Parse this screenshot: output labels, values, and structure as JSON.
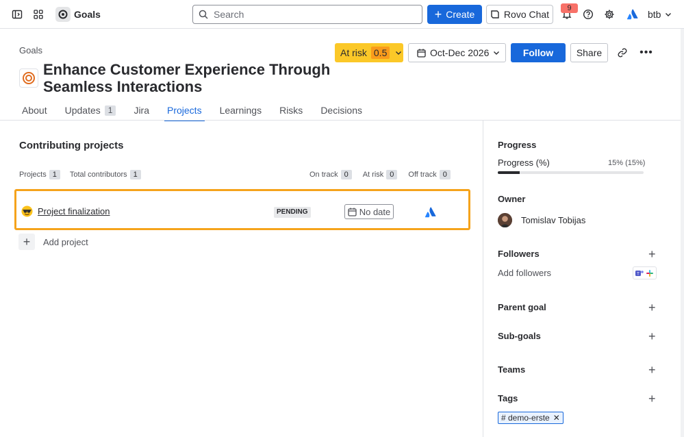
{
  "topnav": {
    "app_name": "Goals",
    "search_placeholder": "Search",
    "create_label": "Create",
    "rovo_label": "Rovo Chat",
    "notification_count": "9",
    "user_label": "btb"
  },
  "header": {
    "breadcrumb": "Goals",
    "title": "Enhance Customer Experience Through Seamless Interactions",
    "status_label": "At risk",
    "status_score": "0.5",
    "date_range": "Oct-Dec 2026",
    "follow_label": "Follow",
    "share_label": "Share"
  },
  "tabs": [
    {
      "label": "About",
      "count": ""
    },
    {
      "label": "Updates",
      "count": "1"
    },
    {
      "label": "Jira",
      "count": ""
    },
    {
      "label": "Projects",
      "count": "",
      "active": true
    },
    {
      "label": "Learnings",
      "count": ""
    },
    {
      "label": "Risks",
      "count": ""
    },
    {
      "label": "Decisions",
      "count": ""
    }
  ],
  "main": {
    "section_title": "Contributing projects",
    "stats": {
      "projects_label": "Projects",
      "projects_count": "1",
      "contributors_label": "Total contributors",
      "contributors_count": "1",
      "on_track_label": "On track",
      "on_track_count": "0",
      "at_risk_label": "At risk",
      "at_risk_count": "0",
      "off_track_label": "Off track",
      "off_track_count": "0"
    },
    "projects": [
      {
        "emoji": "😎",
        "name": "Project finalization",
        "status": "PENDING",
        "date": "No date"
      }
    ],
    "add_project_label": "Add project"
  },
  "sidebar": {
    "progress_heading": "Progress",
    "progress_label": "Progress (%)",
    "progress_value": "15% (15%)",
    "progress_fraction": 0.15,
    "owner_heading": "Owner",
    "owner_name": "Tomislav Tobijas",
    "followers_heading": "Followers",
    "add_followers": "Add followers",
    "parent_goal_heading": "Parent goal",
    "sub_goals_heading": "Sub-goals",
    "teams_heading": "Teams",
    "tags_heading": "Tags",
    "tags": [
      "# demo-erste"
    ]
  },
  "colors": {
    "accent": "#1868db",
    "at_risk": "#fbc828",
    "highlight": "#f5a31b"
  }
}
